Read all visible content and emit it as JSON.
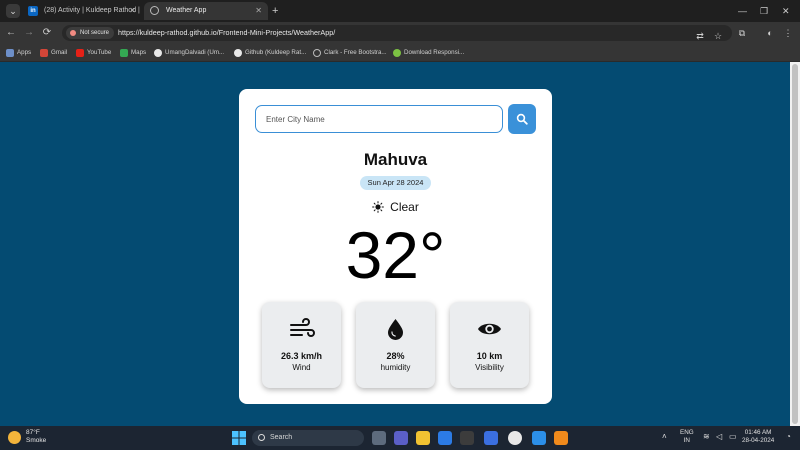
{
  "browser": {
    "tabs": [
      {
        "label": "(28) Activity | Kuldeep Rathod |",
        "icon": "linkedin-icon"
      },
      {
        "label": "Weather App",
        "icon": "globe-icon"
      }
    ],
    "new_tab": "+",
    "nav": {
      "back": "←",
      "forward": "→",
      "reload": "⟳"
    },
    "security_chip": "Not secure",
    "url": "https://kuldeep-rathod.github.io/Frontend-Mini-Projects/WeatherApp/",
    "bookmarks": [
      {
        "label": "Apps",
        "icon": "apps-grid-icon"
      },
      {
        "label": "Gmail",
        "icon": "gmail-icon"
      },
      {
        "label": "YouTube",
        "icon": "youtube-icon"
      },
      {
        "label": "Maps",
        "icon": "maps-icon"
      },
      {
        "label": "UmangDalvadi (Um...",
        "icon": "github-icon"
      },
      {
        "label": "Github (Kuldeep Rat...",
        "icon": "github-icon"
      },
      {
        "label": "Clark - Free Bootstra...",
        "icon": "globe-icon"
      },
      {
        "label": "Download Responsi...",
        "icon": "leaf-icon"
      }
    ]
  },
  "app": {
    "search": {
      "placeholder": "Enter City Name",
      "value": ""
    },
    "city": "Mahuva",
    "date": "Sun Apr 28 2024",
    "condition": "Clear",
    "temperature": "32°",
    "stats": [
      {
        "value": "26.3 km/h",
        "label": "Wind",
        "icon": "wind-icon"
      },
      {
        "value": "28%",
        "label": "humidity",
        "icon": "droplet-icon"
      },
      {
        "value": "10 km",
        "label": "Visibility",
        "icon": "eye-icon"
      }
    ]
  },
  "taskbar": {
    "weather_temp": "87°F",
    "weather_desc": "Smoke",
    "search_label": "Search",
    "lang_top": "ENG",
    "lang_bottom": "IN",
    "time": "01:46 AM",
    "date": "28-04-2024"
  },
  "colors": {
    "page_bg": "#044b72",
    "accent": "#3a91d9",
    "date_pill": "#c9e5f6",
    "stat_card": "#ebedef"
  }
}
